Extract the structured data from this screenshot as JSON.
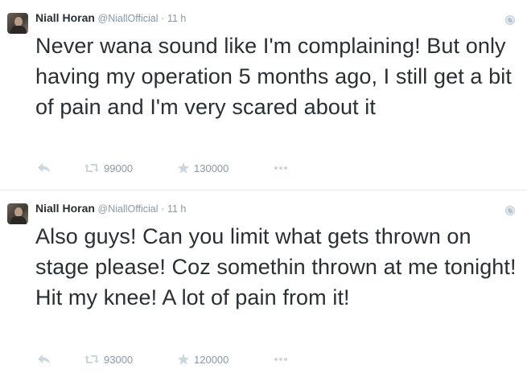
{
  "tweets": [
    {
      "author_name": "Niall Horan",
      "handle": "@NiallOfficial",
      "separator": "·",
      "time": "11 h",
      "text": "Never wana sound like I'm complaining! But only having my operation 5 months ago, I still get a bit of pain and I'm very scared about it",
      "retweets": "99000",
      "favorites": "130000"
    },
    {
      "author_name": "Niall Horan",
      "handle": "@NiallOfficial",
      "separator": "·",
      "time": "11 h",
      "text": "Also guys! Can you limit what gets thrown on stage please! Coz somethin thrown at me tonight! Hit my knee! A lot of pain from it!",
      "retweets": "93000",
      "favorites": "120000"
    }
  ],
  "icons": {
    "reply": "reply-icon",
    "retweet": "retweet-icon",
    "favorite": "star-icon",
    "more": "more-dots-icon",
    "globe": "globe-icon"
  },
  "colors": {
    "text": "#292f33",
    "muted": "#8899a6",
    "icon": "#ccd6dd"
  }
}
